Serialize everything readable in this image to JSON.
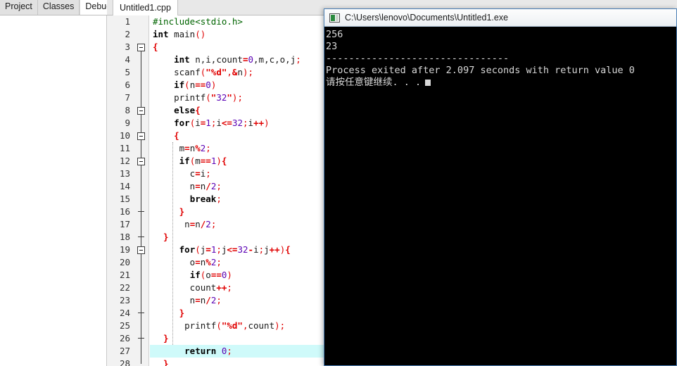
{
  "left_panel": {
    "tabs": [
      {
        "label": "Project",
        "active": false
      },
      {
        "label": "Classes",
        "active": false
      },
      {
        "label": "Debug",
        "active": true
      }
    ]
  },
  "editor": {
    "tab_label": "Untitled1.cpp",
    "highlight_line": 27,
    "lines": [
      {
        "n": 1,
        "fold": "none",
        "indent_guide": false,
        "tokens": [
          {
            "t": "#include<stdio.h>",
            "c": "pre"
          }
        ]
      },
      {
        "n": 2,
        "fold": "none",
        "indent_guide": false,
        "tokens": [
          {
            "t": "int",
            "c": "kw"
          },
          {
            "t": " main",
            "c": "id"
          },
          {
            "t": "()",
            "c": "punc"
          }
        ]
      },
      {
        "n": 3,
        "fold": "box",
        "indent_guide": false,
        "tokens": [
          {
            "t": "{",
            "c": "brace"
          }
        ]
      },
      {
        "n": 4,
        "fold": "line",
        "indent_guide": false,
        "tokens": [
          {
            "t": "    ",
            "c": "id"
          },
          {
            "t": "int",
            "c": "kw"
          },
          {
            "t": " n,i,count",
            "c": "id"
          },
          {
            "t": "=",
            "c": "op"
          },
          {
            "t": "0",
            "c": "num"
          },
          {
            "t": ",m,c,o,j",
            "c": "id"
          },
          {
            "t": ";",
            "c": "punc"
          }
        ]
      },
      {
        "n": 5,
        "fold": "line",
        "indent_guide": false,
        "tokens": [
          {
            "t": "    scanf",
            "c": "id"
          },
          {
            "t": "(",
            "c": "punc"
          },
          {
            "t": "\"%d\"",
            "c": "str"
          },
          {
            "t": ",",
            "c": "punc"
          },
          {
            "t": "&",
            "c": "op"
          },
          {
            "t": "n",
            "c": "id"
          },
          {
            "t": ");",
            "c": "punc"
          }
        ]
      },
      {
        "n": 6,
        "fold": "line",
        "indent_guide": false,
        "tokens": [
          {
            "t": "    ",
            "c": "id"
          },
          {
            "t": "if",
            "c": "kw"
          },
          {
            "t": "(",
            "c": "punc"
          },
          {
            "t": "n",
            "c": "id"
          },
          {
            "t": "==",
            "c": "op"
          },
          {
            "t": "0",
            "c": "num"
          },
          {
            "t": ")",
            "c": "punc"
          }
        ]
      },
      {
        "n": 7,
        "fold": "line",
        "indent_guide": false,
        "tokens": [
          {
            "t": "    printf",
            "c": "id"
          },
          {
            "t": "(",
            "c": "punc"
          },
          {
            "t": "\"",
            "c": "str"
          },
          {
            "t": "32",
            "c": "num"
          },
          {
            "t": "\"",
            "c": "str"
          },
          {
            "t": ");",
            "c": "punc"
          }
        ]
      },
      {
        "n": 8,
        "fold": "box",
        "indent_guide": false,
        "tokens": [
          {
            "t": "    ",
            "c": "id"
          },
          {
            "t": "else",
            "c": "kw"
          },
          {
            "t": "{",
            "c": "brace"
          }
        ]
      },
      {
        "n": 9,
        "fold": "line",
        "indent_guide": false,
        "tokens": [
          {
            "t": "    ",
            "c": "id"
          },
          {
            "t": "for",
            "c": "kw"
          },
          {
            "t": "(",
            "c": "punc"
          },
          {
            "t": "i",
            "c": "id"
          },
          {
            "t": "=",
            "c": "op"
          },
          {
            "t": "1",
            "c": "num"
          },
          {
            "t": ";",
            "c": "punc"
          },
          {
            "t": "i",
            "c": "id"
          },
          {
            "t": "<=",
            "c": "op"
          },
          {
            "t": "32",
            "c": "num"
          },
          {
            "t": ";",
            "c": "punc"
          },
          {
            "t": "i",
            "c": "id"
          },
          {
            "t": "++",
            "c": "op"
          },
          {
            "t": ")",
            "c": "punc"
          }
        ]
      },
      {
        "n": 10,
        "fold": "box",
        "indent_guide": false,
        "tokens": [
          {
            "t": "    {",
            "c": "brace"
          }
        ]
      },
      {
        "n": 11,
        "fold": "line",
        "indent_guide": true,
        "tokens": [
          {
            "t": "     m",
            "c": "id"
          },
          {
            "t": "=",
            "c": "op"
          },
          {
            "t": "n",
            "c": "id"
          },
          {
            "t": "%",
            "c": "op"
          },
          {
            "t": "2",
            "c": "num"
          },
          {
            "t": ";",
            "c": "punc"
          }
        ]
      },
      {
        "n": 12,
        "fold": "box",
        "indent_guide": true,
        "tokens": [
          {
            "t": "     ",
            "c": "id"
          },
          {
            "t": "if",
            "c": "kw"
          },
          {
            "t": "(",
            "c": "punc"
          },
          {
            "t": "m",
            "c": "id"
          },
          {
            "t": "==",
            "c": "op"
          },
          {
            "t": "1",
            "c": "num"
          },
          {
            "t": ")",
            "c": "punc"
          },
          {
            "t": "{",
            "c": "brace"
          }
        ]
      },
      {
        "n": 13,
        "fold": "line",
        "indent_guide": true,
        "tokens": [
          {
            "t": "       c",
            "c": "id"
          },
          {
            "t": "=",
            "c": "op"
          },
          {
            "t": "i",
            "c": "id"
          },
          {
            "t": ";",
            "c": "punc"
          }
        ]
      },
      {
        "n": 14,
        "fold": "line",
        "indent_guide": true,
        "tokens": [
          {
            "t": "       n",
            "c": "id"
          },
          {
            "t": "=",
            "c": "op"
          },
          {
            "t": "n",
            "c": "id"
          },
          {
            "t": "/",
            "c": "op"
          },
          {
            "t": "2",
            "c": "num"
          },
          {
            "t": ";",
            "c": "punc"
          }
        ]
      },
      {
        "n": 15,
        "fold": "line",
        "indent_guide": true,
        "tokens": [
          {
            "t": "       ",
            "c": "id"
          },
          {
            "t": "break",
            "c": "kw"
          },
          {
            "t": ";",
            "c": "punc"
          }
        ]
      },
      {
        "n": 16,
        "fold": "tick",
        "indent_guide": true,
        "tokens": [
          {
            "t": "     }",
            "c": "brace"
          }
        ]
      },
      {
        "n": 17,
        "fold": "line",
        "indent_guide": true,
        "tokens": [
          {
            "t": "      n",
            "c": "id"
          },
          {
            "t": "=",
            "c": "op"
          },
          {
            "t": "n",
            "c": "id"
          },
          {
            "t": "/",
            "c": "op"
          },
          {
            "t": "2",
            "c": "num"
          },
          {
            "t": ";",
            "c": "punc"
          }
        ]
      },
      {
        "n": 18,
        "fold": "tick",
        "indent_guide": false,
        "tokens": [
          {
            "t": "  }",
            "c": "brace"
          }
        ]
      },
      {
        "n": 19,
        "fold": "box",
        "indent_guide": true,
        "tokens": [
          {
            "t": "     ",
            "c": "id"
          },
          {
            "t": "for",
            "c": "kw"
          },
          {
            "t": "(",
            "c": "punc"
          },
          {
            "t": "j",
            "c": "id"
          },
          {
            "t": "=",
            "c": "op"
          },
          {
            "t": "1",
            "c": "num"
          },
          {
            "t": ";",
            "c": "punc"
          },
          {
            "t": "j",
            "c": "id"
          },
          {
            "t": "<=",
            "c": "op"
          },
          {
            "t": "32",
            "c": "num"
          },
          {
            "t": "-",
            "c": "op"
          },
          {
            "t": "i",
            "c": "id"
          },
          {
            "t": ";",
            "c": "punc"
          },
          {
            "t": "j",
            "c": "id"
          },
          {
            "t": "++",
            "c": "op"
          },
          {
            "t": ")",
            "c": "punc"
          },
          {
            "t": "{",
            "c": "brace"
          }
        ]
      },
      {
        "n": 20,
        "fold": "line",
        "indent_guide": true,
        "tokens": [
          {
            "t": "       o",
            "c": "id"
          },
          {
            "t": "=",
            "c": "op"
          },
          {
            "t": "n",
            "c": "id"
          },
          {
            "t": "%",
            "c": "op"
          },
          {
            "t": "2",
            "c": "num"
          },
          {
            "t": ";",
            "c": "punc"
          }
        ]
      },
      {
        "n": 21,
        "fold": "line",
        "indent_guide": true,
        "tokens": [
          {
            "t": "       ",
            "c": "id"
          },
          {
            "t": "if",
            "c": "kw"
          },
          {
            "t": "(",
            "c": "punc"
          },
          {
            "t": "o",
            "c": "id"
          },
          {
            "t": "==",
            "c": "op"
          },
          {
            "t": "0",
            "c": "num"
          },
          {
            "t": ")",
            "c": "punc"
          }
        ]
      },
      {
        "n": 22,
        "fold": "line",
        "indent_guide": true,
        "tokens": [
          {
            "t": "       count",
            "c": "id"
          },
          {
            "t": "++",
            "c": "op"
          },
          {
            "t": ";",
            "c": "punc"
          }
        ]
      },
      {
        "n": 23,
        "fold": "line",
        "indent_guide": true,
        "tokens": [
          {
            "t": "       n",
            "c": "id"
          },
          {
            "t": "=",
            "c": "op"
          },
          {
            "t": "n",
            "c": "id"
          },
          {
            "t": "/",
            "c": "op"
          },
          {
            "t": "2",
            "c": "num"
          },
          {
            "t": ";",
            "c": "punc"
          }
        ]
      },
      {
        "n": 24,
        "fold": "tick",
        "indent_guide": true,
        "tokens": [
          {
            "t": "     }",
            "c": "brace"
          }
        ]
      },
      {
        "n": 25,
        "fold": "line",
        "indent_guide": true,
        "tokens": [
          {
            "t": "      printf",
            "c": "id"
          },
          {
            "t": "(",
            "c": "punc"
          },
          {
            "t": "\"%d\"",
            "c": "str"
          },
          {
            "t": ",",
            "c": "punc"
          },
          {
            "t": "count",
            "c": "id"
          },
          {
            "t": ");",
            "c": "punc"
          }
        ]
      },
      {
        "n": 26,
        "fold": "tick",
        "indent_guide": false,
        "tokens": [
          {
            "t": "  }",
            "c": "brace"
          }
        ]
      },
      {
        "n": 27,
        "fold": "line",
        "indent_guide": true,
        "tokens": [
          {
            "t": "      ",
            "c": "id"
          },
          {
            "t": "return",
            "c": "kw"
          },
          {
            "t": " ",
            "c": "id"
          },
          {
            "t": "0",
            "c": "num"
          },
          {
            "t": ";",
            "c": "punc"
          }
        ]
      },
      {
        "n": 28,
        "fold": "line",
        "indent_guide": false,
        "tokens": [
          {
            "t": "  }",
            "c": "brace"
          }
        ]
      }
    ]
  },
  "console": {
    "title": "C:\\Users\\lenovo\\Documents\\Untitled1.exe",
    "icon": "console-app-icon",
    "output_lines": [
      "256",
      "23",
      "--------------------------------",
      "Process exited after 2.097 seconds with return value 0"
    ],
    "prompt_line": "请按任意键继续. . .",
    "cursor": "block-cursor"
  },
  "colors": {
    "keyword": "#000000",
    "string": "#e00000",
    "number": "#5a00b4",
    "operator": "#e00000",
    "preprocessor": "#006400",
    "current_line_highlight": "#cffafa",
    "console_background": "#000000",
    "console_text": "#d8d8d8",
    "gutter_background": "#f2f2f2"
  }
}
